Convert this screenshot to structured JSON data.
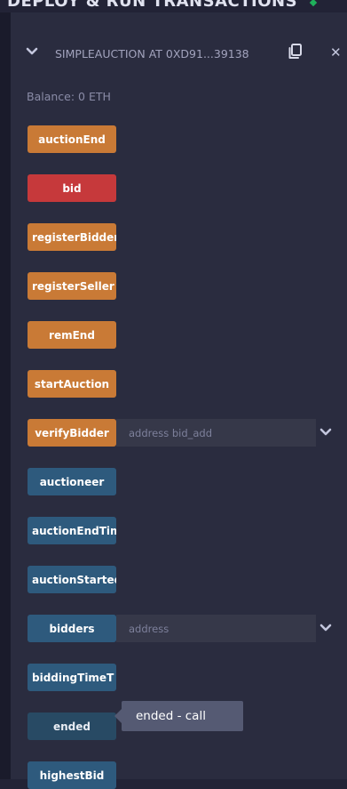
{
  "section_title": "DEPLOY & RUN TRANSACTIONS",
  "contract": {
    "name": "SIMPLEAUCTION AT 0XD91...39138"
  },
  "balance": "Balance: 0 ETH",
  "buttons": {
    "auctionEnd": "auctionEnd",
    "bid": "bid",
    "registerBidder": "registerBidder",
    "registerSeller": "registerSeller",
    "remEnd": "remEnd",
    "startAuction": "startAuction",
    "verifyBidder": "verifyBidder",
    "auctioneer": "auctioneer",
    "auctionEndTime": "auctionEndTime",
    "auctionStarted": "auctionStarted",
    "bidders": "bidders",
    "biddingTime": "biddingTimeT",
    "ended": "ended",
    "highestBid": "highestBid"
  },
  "inputs": {
    "verifyBidder_placeholder": "address bid_add",
    "bidders_placeholder": "address"
  },
  "tooltip": "ended - call",
  "colors": {
    "transact": "#c97a36",
    "payable": "#c6393b",
    "call": "#2e5a7d",
    "panel": "#2a2c3f"
  },
  "icons": {
    "copy": "copy-icon",
    "close": "close-icon",
    "collapse": "chevron-down-icon"
  }
}
